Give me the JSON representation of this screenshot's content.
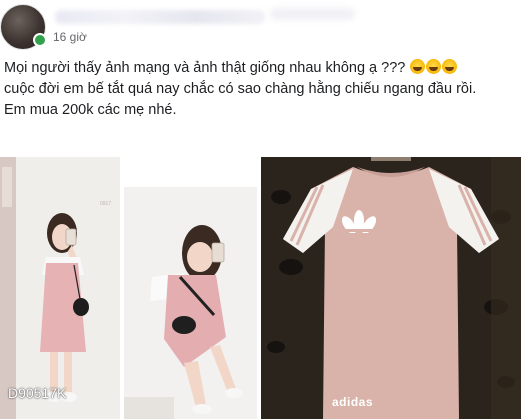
{
  "post": {
    "author_name": "",
    "timestamp": "16 giờ",
    "lines": [
      "Mọi người thấy ảnh mạng và ảnh thật giống nhau không ạ ???",
      "cuộc đời em bế tắt quá nay chắc có sao chàng hằng chiếu ngang đầu rồi.",
      "Em mua 200k các mẹ nhé."
    ],
    "emoji_names": [
      "rofl-emoji",
      "rofl-emoji",
      "rofl-emoji"
    ]
  },
  "photos": {
    "photo1_caption": "D90517K",
    "photo3_brand": "adidas"
  },
  "colors": {
    "text": "#1c1e21",
    "meta": "#65676b",
    "online": "#31a24c",
    "dress_pink": "#e6b2b4",
    "tshirt_pink": "#d9b3aa"
  }
}
